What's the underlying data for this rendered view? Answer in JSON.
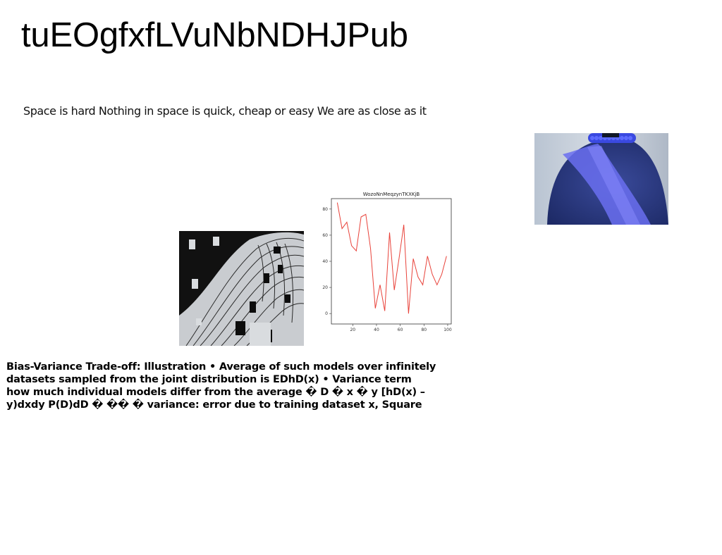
{
  "page": {
    "title": "tuEOgfxfLVuNbNDHJPub",
    "subtitle": "Space is hard Nothing in space is quick, cheap or easy We are as close as it",
    "body_lines": [
      "Bias-Variance Trade-off: Illustration • Average of such models over infinitely",
      "datasets sampled from the joint distribution is EDhD(x) • Variance term",
      "how much individual models differ from the average � D � x � y [hD(x) –",
      "y)dxdy P(D)dD � �� � variance: error due to training dataset x, Square"
    ]
  },
  "images": {
    "back_photo": "photo of person's back with blue sheer fabric",
    "art_image": "black and white abstract line art"
  },
  "chart_data": {
    "type": "line",
    "title": "WozoNnMeqzynTKXKjB",
    "xlabel": "",
    "ylabel": "",
    "x": [
      7,
      11,
      15,
      19,
      23,
      27,
      31,
      35,
      39,
      43,
      47,
      51,
      55,
      59,
      63,
      67,
      71,
      75,
      79,
      83,
      87,
      91,
      95,
      99
    ],
    "y": [
      85,
      65,
      70,
      52,
      48,
      74,
      76,
      50,
      4,
      22,
      2,
      62,
      18,
      42,
      68,
      0,
      42,
      28,
      22,
      44,
      30,
      22,
      30,
      44
    ],
    "xlim": [
      2,
      103
    ],
    "ylim": [
      -8,
      88
    ],
    "xticks": [
      20,
      40,
      60,
      80,
      100
    ],
    "yticks": [
      0,
      20,
      40,
      60,
      80
    ],
    "line_color": "#e8423a",
    "grid": false
  }
}
